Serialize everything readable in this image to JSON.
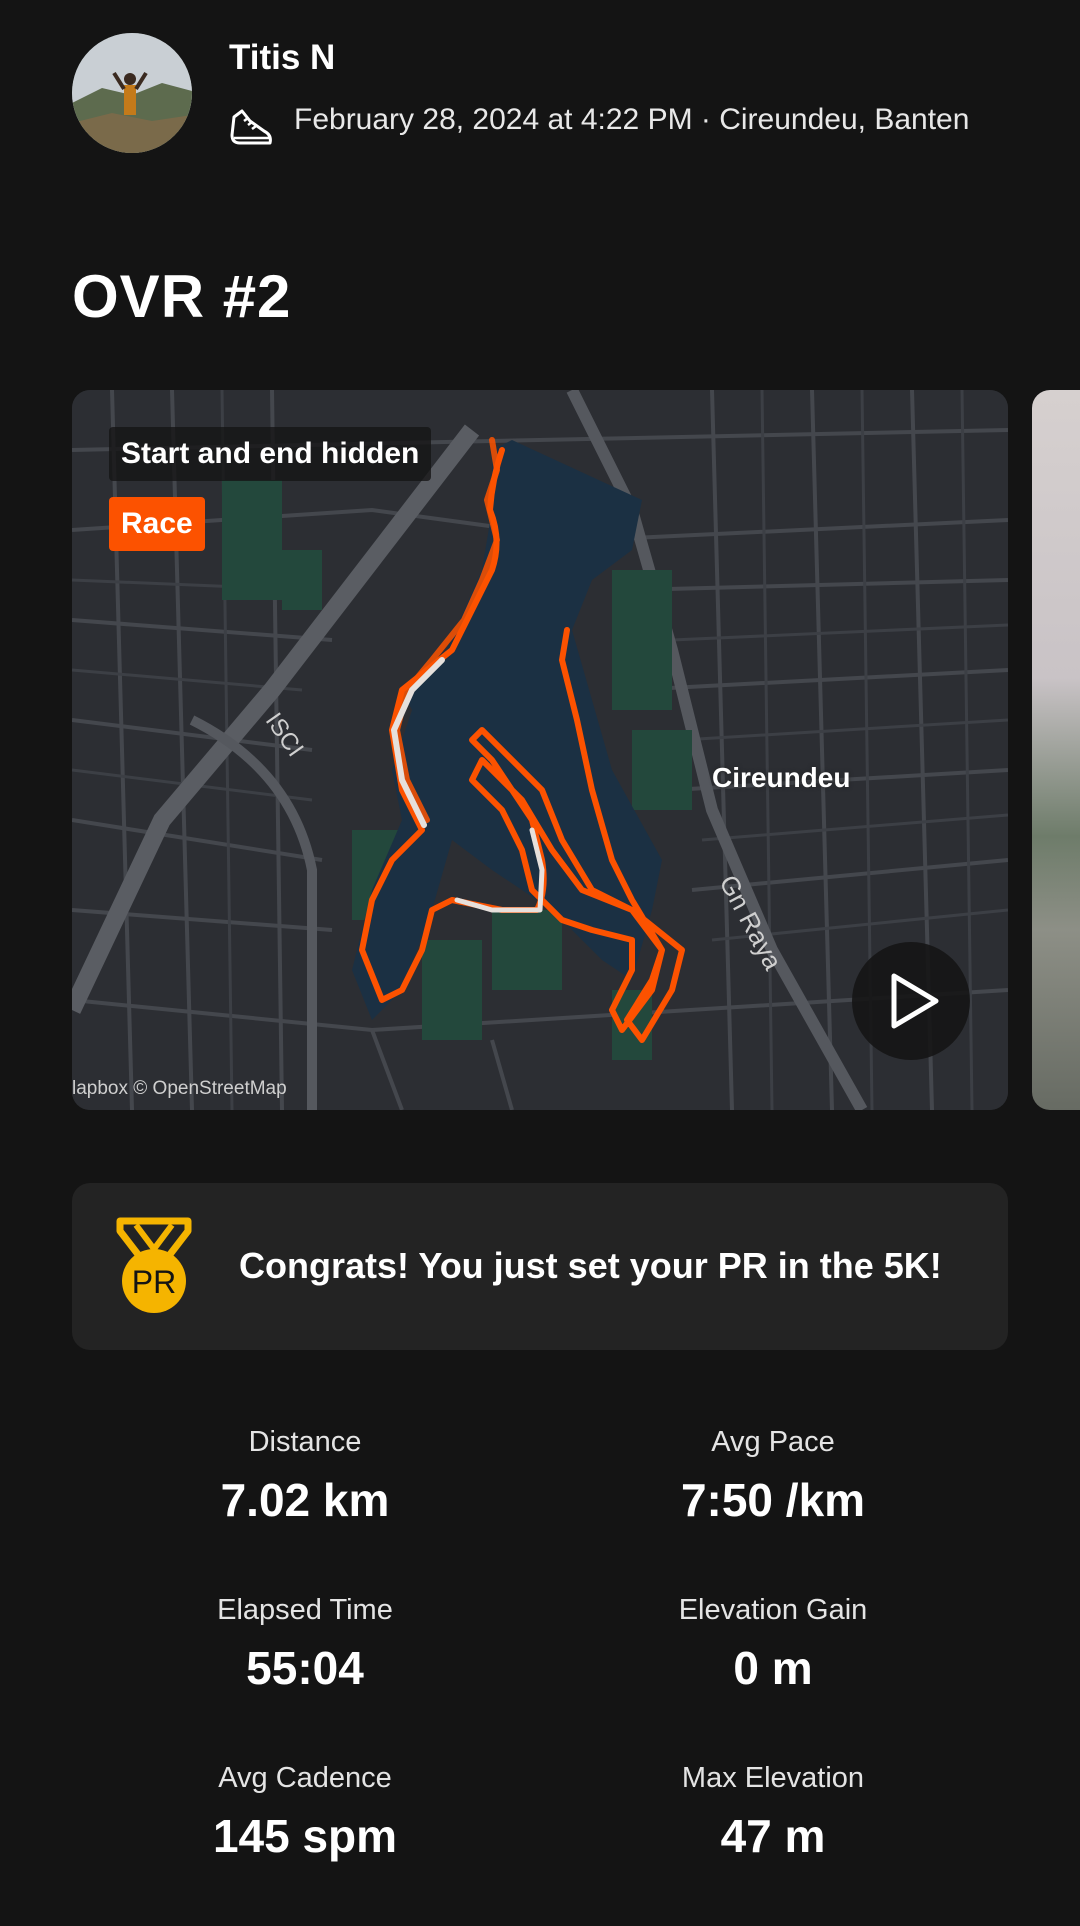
{
  "header": {
    "author_name": "Titis N",
    "activity_meta": "February 28, 2024 at 4:22 PM · Cireundeu, Banten",
    "activity_icon": "running-shoe-icon"
  },
  "activity": {
    "title": "OVR #2"
  },
  "map": {
    "privacy_badge": "Start and end hidden",
    "type_badge": "Race",
    "place_label": "Cireundeu",
    "road_label_1": "ISCI",
    "road_label_2": "Gn Raya",
    "attribution": "lapbox © OpenStreetMap",
    "play_icon": "play-icon",
    "route_color": "#fc5200",
    "water_color": "#1b3043"
  },
  "achievement": {
    "icon": "pr-medal-icon",
    "medal_text": "PR",
    "message": "Congrats! You just set your PR in the 5K!"
  },
  "stats": [
    {
      "label": "Distance",
      "value": "7.02 km"
    },
    {
      "label": "Avg Pace",
      "value": "7:50 /km"
    },
    {
      "label": "Elapsed Time",
      "value": "55:04"
    },
    {
      "label": "Elevation Gain",
      "value": "0 m"
    },
    {
      "label": "Avg Cadence",
      "value": "145 spm"
    },
    {
      "label": "Max Elevation",
      "value": "47 m"
    }
  ],
  "colors": {
    "background": "#141414",
    "card": "#232323",
    "accent": "#fc5200",
    "medal": "#f5b400"
  }
}
